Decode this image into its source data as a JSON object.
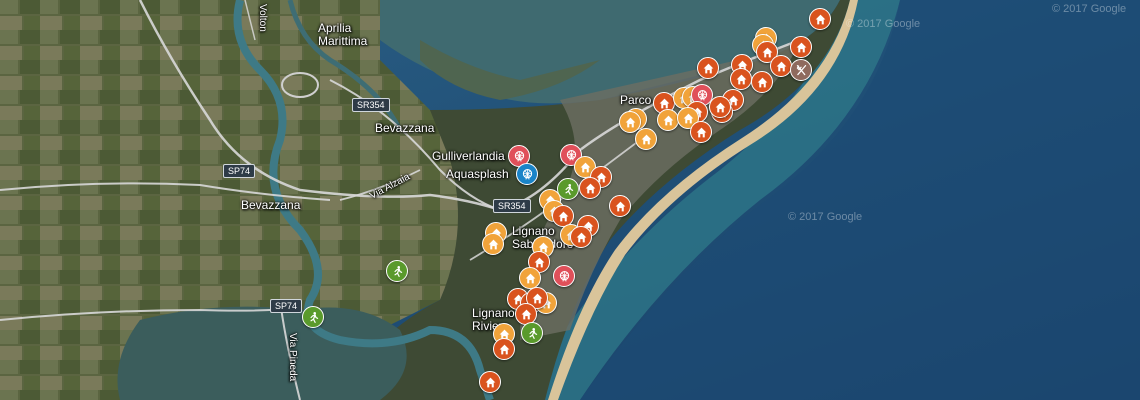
{
  "place_labels": {
    "aprilia": "Aprilia\nMarittima",
    "bevazzana_1": "Bevazzana",
    "bevazzana_2": "Bevazzana",
    "gulliverlandia": "Gulliverlandia",
    "aquasplash": "Aquasplash",
    "parco": "Parco",
    "lignano_sabbiadoro": "Lignano\nSabbiadoro",
    "lignano_riviera": "Lignano\nRiviera"
  },
  "road_labels": {
    "sr354_north": "SR354",
    "sr354_south": "SR354",
    "sp74_a": "SP74",
    "sp74_b": "SP74",
    "via_alzaia": "Via Alzaia",
    "via_pineda": "Via Pineda",
    "volton": "Volton"
  },
  "copyrights": [
    "© 2017 Google",
    "© 2017 Google",
    "© 2017 Google"
  ],
  "colors": {
    "sea": "#27527a",
    "lagoon": "#3d5a58",
    "land": "#4f5a3c",
    "hotel": "#d9531e",
    "campsite": "#f1a33a",
    "attraction": "#e0505a",
    "sport": "#5a9a2c",
    "waterpark": "#1a84c8",
    "restaurant": "#8f6a5e"
  },
  "marker_types": {
    "hotel": "house-icon",
    "campsite": "house-icon",
    "attraction": "ferris-wheel-icon",
    "sport": "running-person-icon",
    "waterpark": "ferris-wheel-icon",
    "restaurant": "fork-knife-icon"
  },
  "marker_count": 64
}
